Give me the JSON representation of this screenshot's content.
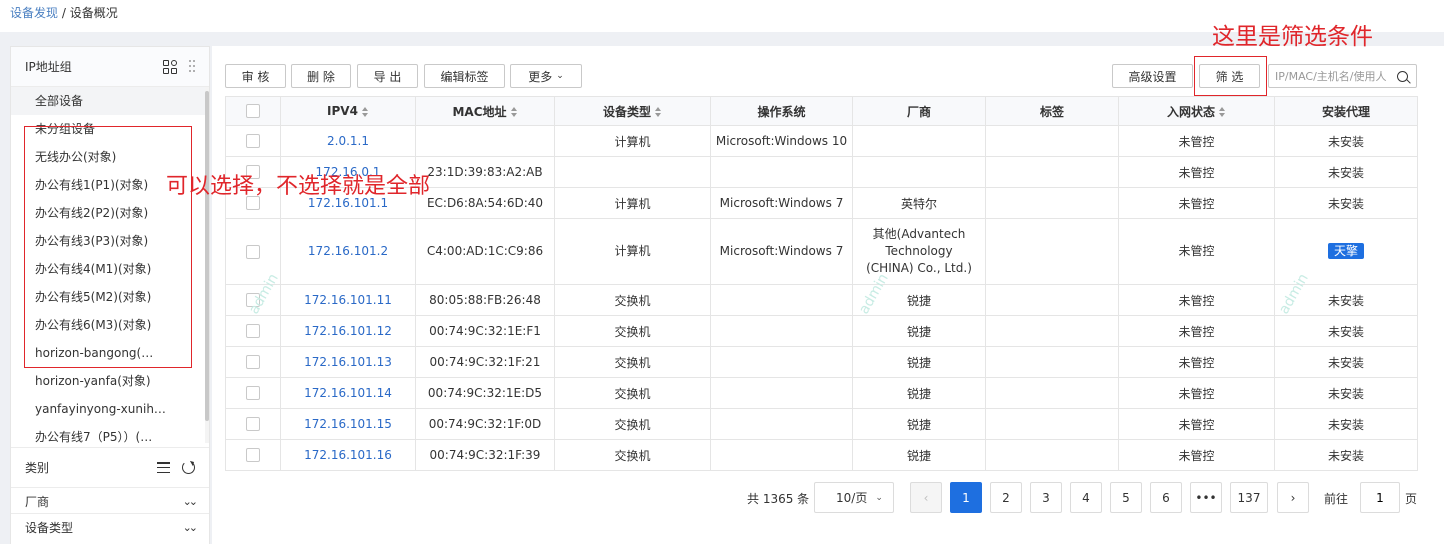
{
  "breadcrumb": {
    "parent": "设备发现",
    "separator": "/",
    "current": "设备概况"
  },
  "left_panel": {
    "title": "IP地址组",
    "groups": [
      "全部设备",
      "未分组设备",
      "无线办公(对象)",
      "办公有线1(P1)(对象)",
      "办公有线2(P2)(对象)",
      "办公有线3(P3)(对象)",
      "办公有线4(M1)(对象)",
      "办公有线5(M2)(对象)",
      "办公有线6(M3)(对象)",
      "horizon-bangong(…",
      "horizon-yanfa(对象)",
      "yanfayinyong-xunih…",
      "办公有线7（P5））(…"
    ],
    "category_title": "类别",
    "sections": [
      "厂商",
      "设备类型"
    ]
  },
  "annotations": {
    "left_note": "可以选择，不选择就是全部",
    "filter_note": "这里是筛选条件"
  },
  "toolbar": {
    "audit": "审 核",
    "delete": "删 除",
    "export": "导 出",
    "edit_tags": "编辑标签",
    "more": "更多",
    "advanced": "高级设置",
    "filter": "筛 选",
    "search_placeholder": "IP/MAC/主机名/使用人"
  },
  "table": {
    "headers": [
      "IPV4",
      "MAC地址",
      "设备类型",
      "操作系统",
      "厂商",
      "标签",
      "入网状态",
      "安装代理"
    ],
    "rows": [
      {
        "ip": "2.0.1.1",
        "mac": "",
        "type": "计算机",
        "os": "Microsoft:Windows 10",
        "vendor": "",
        "tag": "",
        "status": "未管控",
        "agent": "未安装"
      },
      {
        "ip": "172.16.0.1",
        "mac": "23:1D:39:83:A2:AB",
        "type": "",
        "os": "",
        "vendor": "",
        "tag": "",
        "status": "未管控",
        "agent": "未安装"
      },
      {
        "ip": "172.16.101.1",
        "mac": "EC:D6:8A:54:6D:40",
        "type": "计算机",
        "os": "Microsoft:Windows 7",
        "vendor": "英特尔",
        "tag": "",
        "status": "未管控",
        "agent": "未安装"
      },
      {
        "ip": "172.16.101.2",
        "mac": "C4:00:AD:1C:C9:86",
        "type": "计算机",
        "os": "Microsoft:Windows 7",
        "vendor": "其他(Advantech Technology (CHINA) Co., Ltd.)",
        "tag": "",
        "status": "未管控",
        "agent": "天擎"
      },
      {
        "ip": "172.16.101.11",
        "mac": "80:05:88:FB:26:48",
        "type": "交换机",
        "os": "",
        "vendor": "锐捷",
        "tag": "",
        "status": "未管控",
        "agent": "未安装"
      },
      {
        "ip": "172.16.101.12",
        "mac": "00:74:9C:32:1E:F1",
        "type": "交换机",
        "os": "",
        "vendor": "锐捷",
        "tag": "",
        "status": "未管控",
        "agent": "未安装"
      },
      {
        "ip": "172.16.101.13",
        "mac": "00:74:9C:32:1F:21",
        "type": "交换机",
        "os": "",
        "vendor": "锐捷",
        "tag": "",
        "status": "未管控",
        "agent": "未安装"
      },
      {
        "ip": "172.16.101.14",
        "mac": "00:74:9C:32:1E:D5",
        "type": "交换机",
        "os": "",
        "vendor": "锐捷",
        "tag": "",
        "status": "未管控",
        "agent": "未安装"
      },
      {
        "ip": "172.16.101.15",
        "mac": "00:74:9C:32:1F:0D",
        "type": "交换机",
        "os": "",
        "vendor": "锐捷",
        "tag": "",
        "status": "未管控",
        "agent": "未安装"
      },
      {
        "ip": "172.16.101.16",
        "mac": "00:74:9C:32:1F:39",
        "type": "交换机",
        "os": "",
        "vendor": "锐捷",
        "tag": "",
        "status": "未管控",
        "agent": "未安装"
      }
    ]
  },
  "watermark_text": "admin",
  "pagination": {
    "total": "共 1365 条",
    "page_size": "10/页",
    "pages": [
      "1",
      "2",
      "3",
      "4",
      "5",
      "6",
      "•••",
      "137"
    ],
    "current": "1",
    "jump_label": "前往",
    "jump_value": "1",
    "page_label": "页"
  },
  "colors": {
    "accent": "#1e6fe0",
    "link": "#2a69c7",
    "annotation": "#e0262b"
  }
}
